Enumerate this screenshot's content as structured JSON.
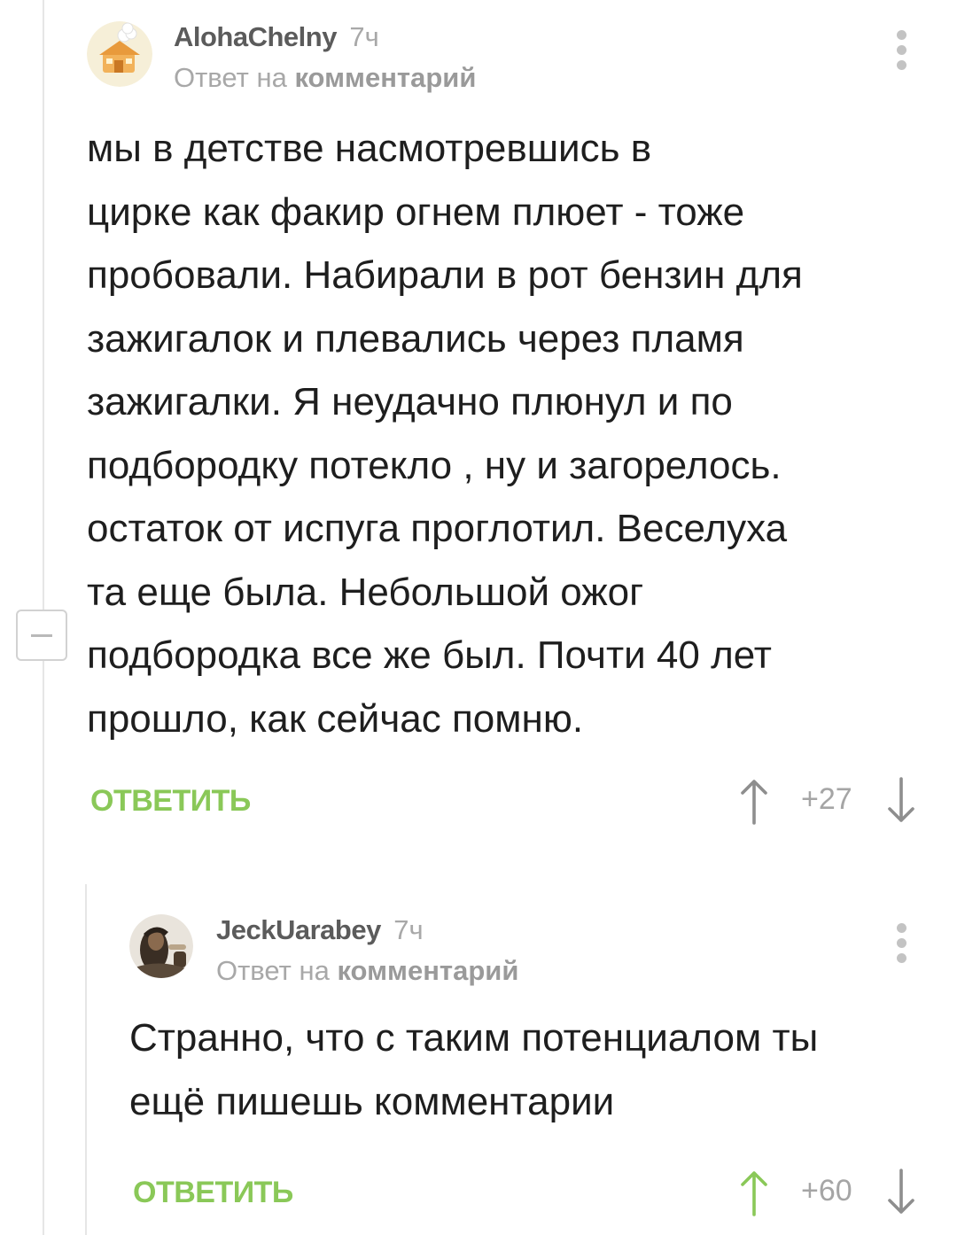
{
  "comments": [
    {
      "author": "AlohaChelny",
      "time": "7ч",
      "reply_prefix": "Ответ на",
      "reply_link": "комментарий",
      "body_lines": [
        "мы в детстве насмотревшись в",
        "цирке как факир огнем плюет - тоже",
        "пробовали. Набирали в рот бензин для",
        "зажигалок и плевались через пламя",
        "зажигалки. Я неудачно плюнул и по",
        "подбородку потекло , ну и загорелось.",
        "остаток от испуга проглотил. Веселуха",
        "та еще была. Небольшой ожог",
        "подбородка все же был. Почти 40 лет",
        "прошло, как сейчас помню."
      ],
      "reply_label": "ОТВЕТИТЬ",
      "score": "+27",
      "voted_up": false
    },
    {
      "author": "JeckUarabey",
      "time": "7ч",
      "reply_prefix": "Ответ на",
      "reply_link": "комментарий",
      "body_lines": [
        "Странно, что с таким потенциалом ты",
        "ещё пишешь комментарии"
      ],
      "reply_label": "ОТВЕТИТЬ",
      "score": "+60",
      "voted_up": true
    }
  ],
  "colors": {
    "accent_green": "#8ac858",
    "vote_neutral": "#8e8e8e",
    "muted_text": "#a8a8a8"
  },
  "icons": {
    "vote_up": "arrow-up-icon",
    "vote_down": "arrow-down-icon",
    "menu": "kebab-menu-icon",
    "collapse": "minus-icon"
  }
}
